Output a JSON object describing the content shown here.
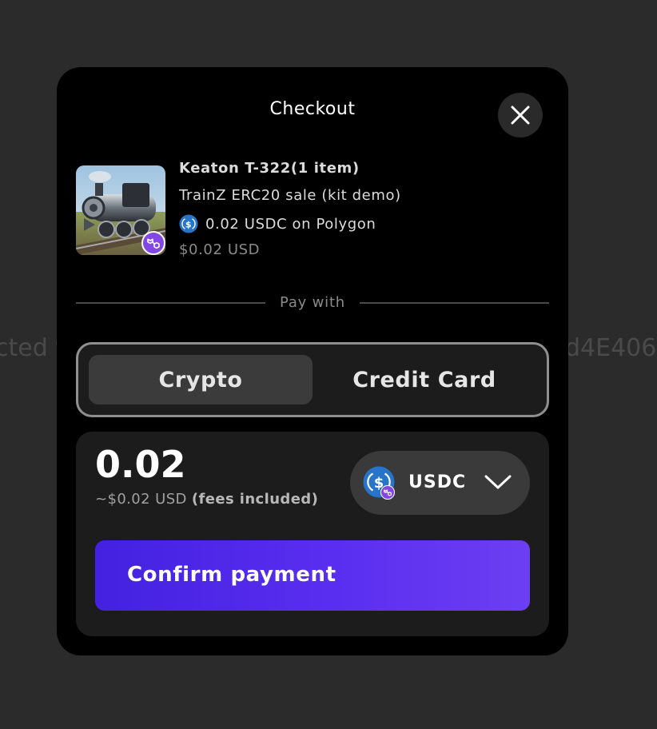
{
  "background": {
    "left_text": "cted t",
    "right_text": "d4E406"
  },
  "checkout": {
    "title": "Checkout",
    "item": {
      "name": "Keaton T-322(1 item)",
      "collection": "TrainZ ERC20 sale (kit demo)",
      "price": "0.02 USDC on Polygon",
      "usd": "$0.02 USD",
      "image": "steam-locomotive-image",
      "chain_badge_icon": "polygon-icon",
      "token_icon": "usdc-icon"
    },
    "divider_label": "Pay with",
    "tabs": [
      {
        "label": "Crypto",
        "active": true
      },
      {
        "label": "Credit Card",
        "active": false
      }
    ],
    "payment": {
      "amount": "0.02",
      "usd_prefix": "~$0.02 USD",
      "fees_note": "(fees included)",
      "token_label": "USDC",
      "token_icon": "usdc-icon",
      "chevron_icon": "chevron-down-icon"
    },
    "confirm_label": "Confirm payment"
  },
  "colors": {
    "accent_start": "#4321e0",
    "accent_end": "#6c3ff2",
    "polygon": "#8247e5",
    "usdc": "#2775ca"
  }
}
